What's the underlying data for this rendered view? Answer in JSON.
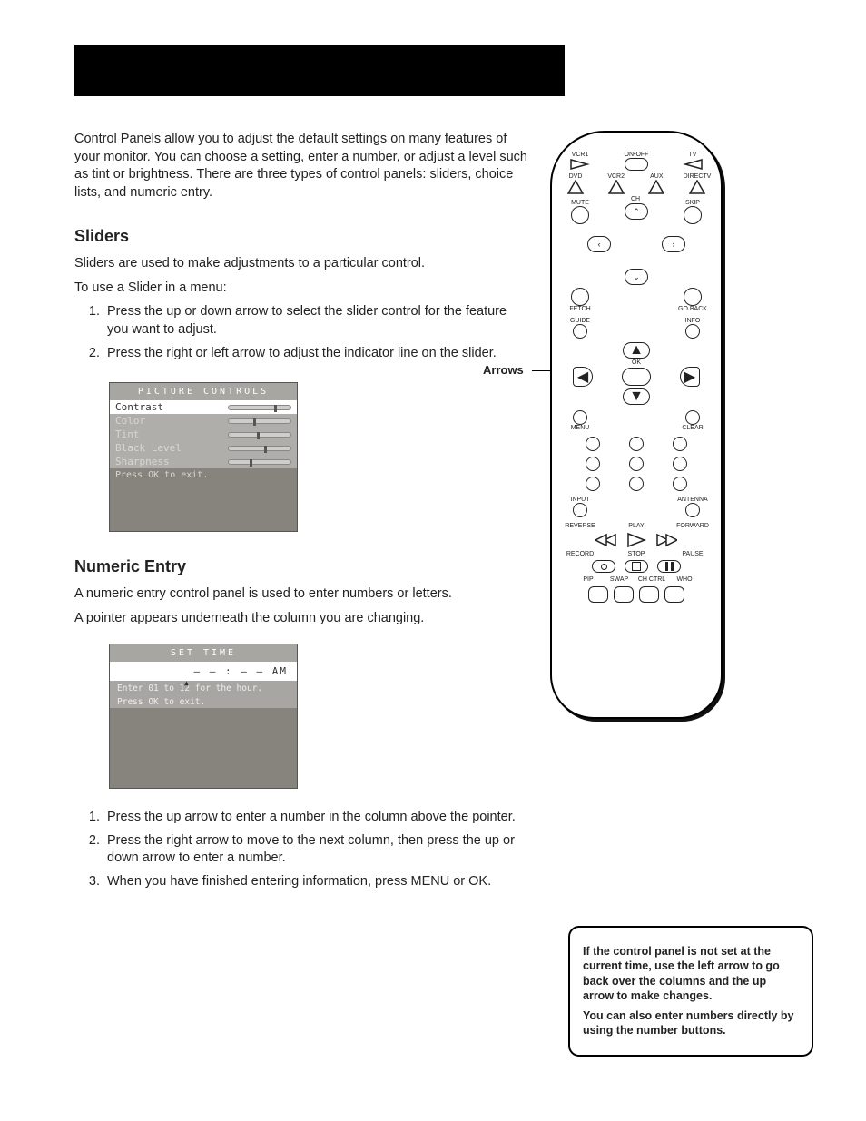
{
  "intro": "Control Panels allow you to adjust the default settings on many features of your monitor. You can choose a setting, enter a number, or adjust a level such as tint or brightness. There are three types of control panels: sliders, choice lists, and numeric entry.",
  "sliders": {
    "heading": "Sliders",
    "p1": "Sliders are used to make adjustments to a particular control.",
    "p2": "To use a Slider in a menu:",
    "steps": [
      "Press the up or down arrow to select the slider control for the feature you want to adjust.",
      "Press the right or left arrow to adjust the indicator line on the slider."
    ]
  },
  "picture_controls": {
    "title": "PICTURE CONTROLS",
    "rows": [
      {
        "label": "Contrast",
        "pos": 74,
        "selected": true
      },
      {
        "label": "Color",
        "pos": 40,
        "selected": false
      },
      {
        "label": "Tint",
        "pos": 46,
        "selected": false
      },
      {
        "label": "Black Level",
        "pos": 58,
        "selected": false
      },
      {
        "label": "Sharpness",
        "pos": 34,
        "selected": false
      }
    ],
    "hint": "Press OK to exit."
  },
  "numeric": {
    "heading": "Numeric Entry",
    "p1": "A numeric entry control panel is used to enter numbers or letters.",
    "p2": "A pointer appears underneath the column you are changing.",
    "steps": [
      "Press the up arrow to enter a number in the column above the pointer.",
      "Press the right arrow to move to the next column, then press the up or down arrow to enter a number.",
      "When you have finished entering information, press MENU or OK."
    ]
  },
  "set_time": {
    "title": "SET TIME",
    "value": "— — : — —  AM",
    "instr1": "Enter 01 to 12 for the hour.",
    "instr2": "Press OK to exit."
  },
  "arrows_label": "Arrows",
  "remote": {
    "row1": [
      "VCR1",
      "ON•OFF",
      "TV"
    ],
    "row2": [
      "DVD",
      "VCR2",
      "AUX",
      "DIRECTV"
    ],
    "mute": "MUTE",
    "skip": "SKIP",
    "ch": "CH",
    "fetch": "FETCH",
    "goback": "GO BACK",
    "guide": "GUIDE",
    "info": "INFO",
    "ok": "OK",
    "menu": "MENU",
    "clear": "CLEAR",
    "input": "INPUT",
    "antenna": "ANTENNA",
    "reverse": "REVERSE",
    "play": "PLAY",
    "forward": "FORWARD",
    "record": "RECORD",
    "stop": "STOP",
    "pause": "PAUSE",
    "bottom": [
      "PIP",
      "SWAP",
      "CH CTRL",
      "WHO"
    ]
  },
  "tip": {
    "p1": "If the control panel is not set at the current time, use the left arrow to go back over the columns and the up arrow to make changes.",
    "p2": "You can also enter numbers directly by using the number buttons."
  }
}
